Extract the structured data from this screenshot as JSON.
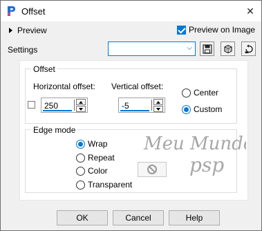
{
  "window": {
    "title": "Offset"
  },
  "toolbar": {
    "preview_label": "Preview",
    "preview_on_image_label": "Preview on Image",
    "preview_on_image_checked": true,
    "settings_label": "Settings",
    "settings_value": "",
    "icons": [
      "save-icon",
      "dice-icon",
      "reset-icon"
    ]
  },
  "offset": {
    "title": "Offset",
    "horizontal_label": "Horizontal offset:",
    "horizontal_value": "250",
    "vertical_label": "Vertical offset:",
    "vertical_value": "-5",
    "link_checked": false,
    "center_label": "Center",
    "custom_label": "Custom",
    "selected": "Custom"
  },
  "edge_mode": {
    "title": "Edge mode",
    "options": [
      "Wrap",
      "Repeat",
      "Color",
      "Transparent"
    ],
    "selected": "Wrap"
  },
  "watermark": {
    "line1": "Meu Mundo",
    "line2": "psp"
  },
  "buttons": {
    "ok": "OK",
    "cancel": "Cancel",
    "help": "Help"
  },
  "colors": {
    "accent": "#0078d7"
  }
}
